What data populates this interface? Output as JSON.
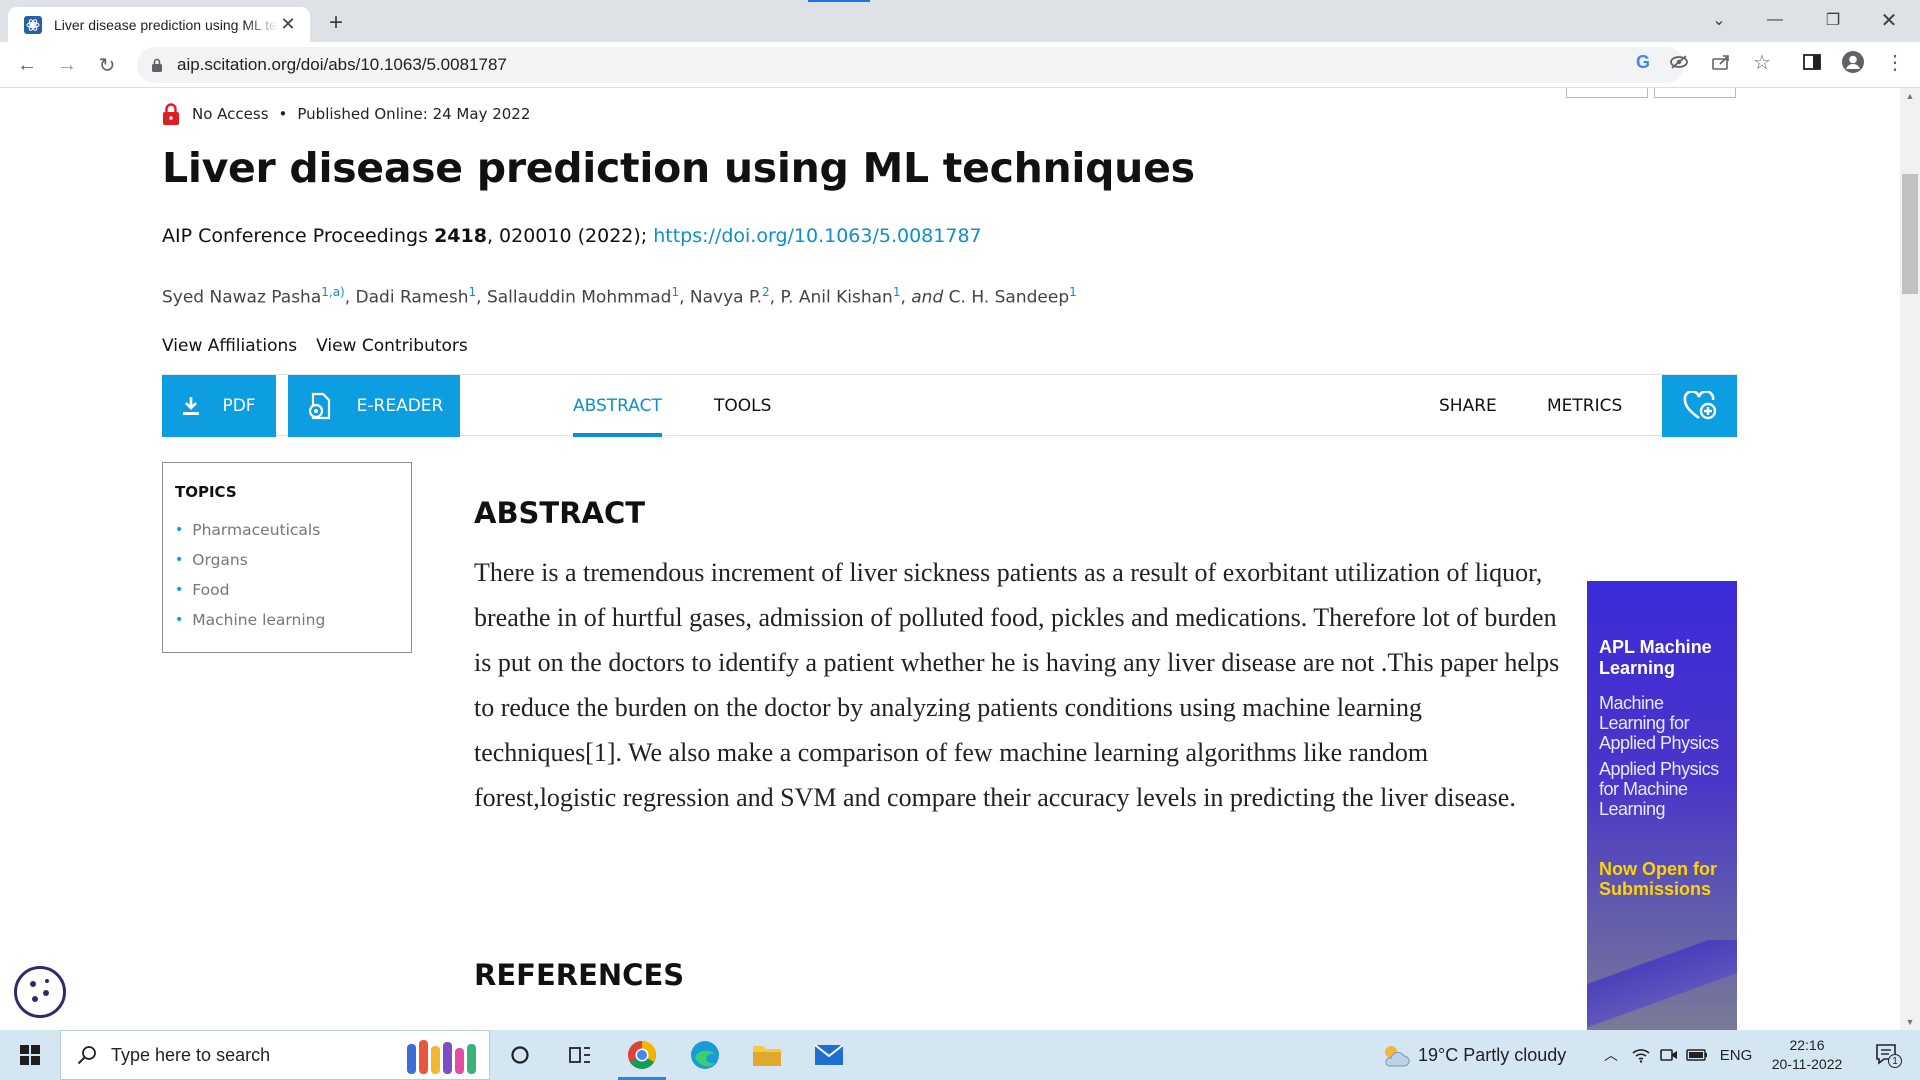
{
  "browser": {
    "tab_title": "Liver disease prediction using ML techniques",
    "new_tab": "+",
    "url": "aip.scitation.org/doi/abs/10.1063/5.0081787"
  },
  "article": {
    "access": "No Access",
    "separator": "•",
    "published": "Published Online: 24 May 2022",
    "title": "Liver disease prediction using ML techniques",
    "citation_prefix": "AIP Conference Proceedings ",
    "citation_volume": "2418",
    "citation_rest": ", 020010 (2022); ",
    "doi_link": "https://doi.org/10.1063/5.0081787",
    "authors": [
      {
        "name": "Syed Nawaz Pasha",
        "sup": "1,a)",
        "sep": ", "
      },
      {
        "name": "Dadi Ramesh",
        "sup": "1",
        "sep": ", "
      },
      {
        "name": "Sallauddin Mohmmad",
        "sup": "1",
        "sep": ", "
      },
      {
        "name": "Navya P.",
        "sup": "2",
        "sep": ", "
      },
      {
        "name": "P. Anil Kishan",
        "sup": "1",
        "sep": ", "
      },
      {
        "name": "C. H. Sandeep",
        "sup": "1",
        "sep": ""
      }
    ],
    "authors_and": "and",
    "view_affiliations": "View Affiliations",
    "view_contributors": "View Contributors"
  },
  "actions": {
    "pdf": "PDF",
    "ereader": "E-READER",
    "abstract_tab": "ABSTRACT",
    "tools_tab": "TOOLS",
    "share": "SHARE",
    "metrics": "METRICS",
    "accent_color": "#0c9ee0"
  },
  "topics": {
    "heading": "TOPICS",
    "items": [
      "Pharmaceuticals",
      "Organs",
      "Food",
      "Machine learning"
    ]
  },
  "abstract": {
    "heading": "ABSTRACT",
    "text": "There is a tremendous increment of liver sickness patients as a result of exorbitant utilization of liquor, breathe in of hurtful gases, admission of polluted food, pickles and medications. Therefore lot of burden is put on the doctors to identify a patient whether he is having any liver disease are not .This paper helps to reduce the burden on the doctor by analyzing patients conditions using machine learning techniques[1]. We also make a comparison of few machine learning algorithms like random forest,logistic regression and SVM and compare their accuracy levels in predicting the liver disease."
  },
  "references": {
    "heading": "REFERENCES"
  },
  "ad": {
    "title": "APL Machine Learning",
    "items": [
      "Machine Learning for Applied Physics",
      "Applied Physics for Machine Learning"
    ],
    "cta": "Now Open for Submissions"
  },
  "taskbar": {
    "search_placeholder": "Type here to search",
    "weather": "19°C  Partly cloudy",
    "lang": "ENG",
    "time": "22:16",
    "date": "20-11-2022",
    "notifications": "1"
  }
}
